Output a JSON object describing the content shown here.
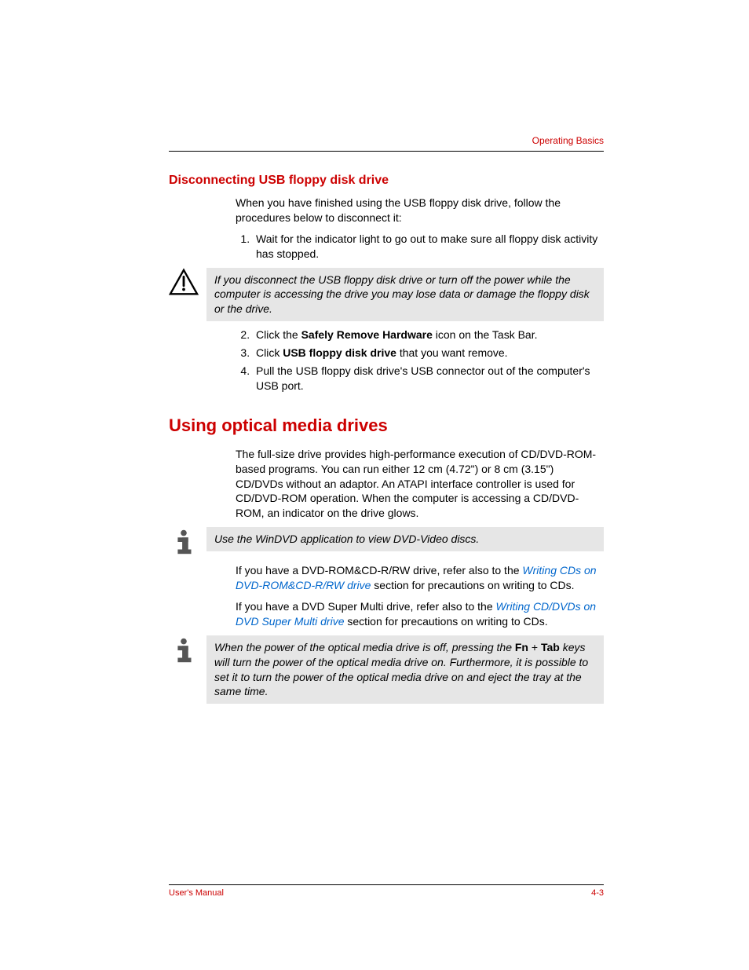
{
  "header": {
    "section": "Operating Basics"
  },
  "section1": {
    "title": "Disconnecting USB floppy disk drive",
    "intro": "When you have finished using the USB floppy disk drive, follow the procedures below to disconnect it:",
    "step1": "Wait for the indicator light to go out to make sure all floppy disk activity has stopped.",
    "caution": "If you disconnect the USB floppy disk drive or turn off the power while the computer is accessing the drive you may lose data or damage the floppy disk or the drive.",
    "step2_pre": "Click the ",
    "step2_bold": "Safely Remove Hardware",
    "step2_post": " icon on the Task Bar.",
    "step3_pre": "Click ",
    "step3_bold": "USB floppy disk drive",
    "step3_post": " that you want remove.",
    "step4": "Pull the USB floppy disk drive's USB connector out of the computer's USB port."
  },
  "section2": {
    "title": "Using optical media drives",
    "intro": "The full-size drive provides high-performance execution of CD/DVD-ROM-based programs. You can run either 12 cm (4.72\") or 8 cm (3.15\") CD/DVDs without an adaptor. An ATAPI interface controller is used for CD/DVD-ROM operation. When the computer is accessing a CD/DVD-ROM, an indicator on the drive glows.",
    "note1": "Use the WinDVD application to view DVD-Video discs.",
    "p1_pre": "If you have a DVD-ROM&CD-R/RW drive, refer also to the ",
    "p1_link": "Writing CDs on DVD-ROM&CD-R/RW drive",
    "p1_post": " section for precautions on writing to CDs.",
    "p2_pre": "If you have a DVD Super Multi drive, refer also to the ",
    "p2_link": "Writing CD/DVDs on DVD Super Multi drive",
    "p2_post": " section for precautions on writing to CDs.",
    "note2_pre": "When the power of the optical media drive is off, pressing the ",
    "note2_b1": "Fn",
    "note2_mid": " + ",
    "note2_b2": "Tab",
    "note2_post": " keys will turn the power of the optical media drive on. Furthermore, it is possible to set it to turn the power of the optical media drive on and eject the tray at the same time."
  },
  "footer": {
    "left": "User's Manual",
    "right": "4-3"
  }
}
